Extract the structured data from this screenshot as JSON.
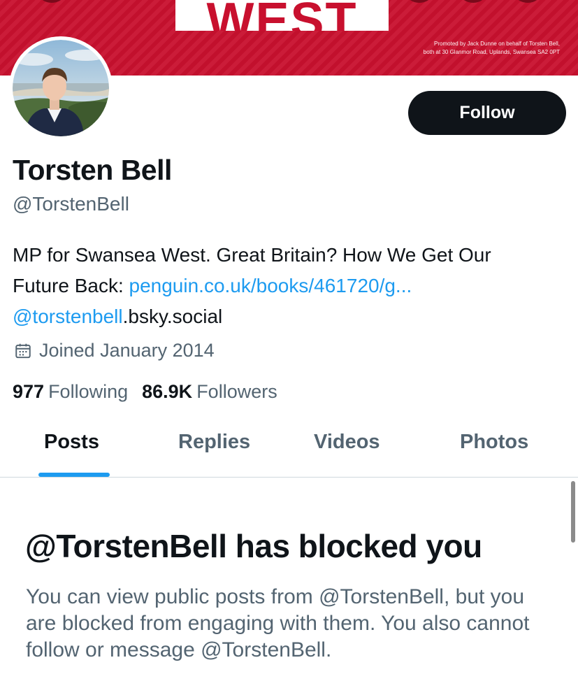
{
  "banner": {
    "word": "WEST",
    "promoted_line1": "Promoted by Jack Dunne on behalf of Torsten Bell,",
    "promoted_line2": "both at 30 Glanmor Road, Uplands, Swansea SA2 0PT",
    "color": "#c8102e"
  },
  "profile": {
    "name": "Torsten Bell",
    "handle": "@TorstenBell",
    "bio_line1": "MP for Swansea West. Great Britain? How We Get Our",
    "bio_line2_prefix": "Future Back: ",
    "bio_link": "penguin.co.uk/books/461720/g...",
    "bio_mention": "@torstenbell",
    "bio_suffix": ".bsky.social",
    "joined": "Joined January 2014",
    "following_count": "977",
    "following_label": "Following",
    "followers_count": "86.9K",
    "followers_label": "Followers"
  },
  "actions": {
    "follow_label": "Follow"
  },
  "tabs": [
    {
      "label": "Posts",
      "active": true
    },
    {
      "label": "Replies",
      "active": false
    },
    {
      "label": "Videos",
      "active": false
    },
    {
      "label": "Photos",
      "active": false
    }
  ],
  "blocked": {
    "title": "@TorstenBell has blocked you",
    "message": "You can view public posts from @TorstenBell, but you are blocked from engaging with them. You also cannot follow or message @TorstenBell."
  },
  "colors": {
    "accent": "#1d9bf0",
    "text_primary": "#0f1419",
    "text_secondary": "#536471",
    "follow_button": "#0f1419"
  },
  "icons": {
    "joined": "calendar-icon"
  }
}
